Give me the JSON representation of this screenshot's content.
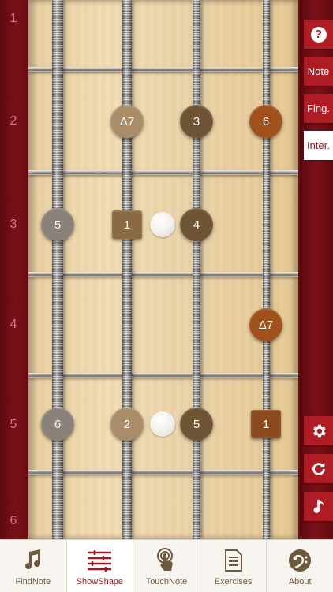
{
  "fret_numbers": [
    "1",
    "2",
    "3",
    "4",
    "5",
    "6"
  ],
  "side_buttons": {
    "help": "?",
    "note": "Note",
    "fingering": "Fing.",
    "interval": "Inter.",
    "settings_icon": "gear-icon",
    "refresh_icon": "refresh-icon",
    "sound_icon": "music-note-icon"
  },
  "notes": {
    "f2_s2": "Δ7",
    "f2_s3": "3",
    "f2_s4": "6",
    "f3_s1": "5",
    "f3_s2": "1",
    "f3_s3": "4",
    "f4_s4": "Δ7",
    "f5_s1": "6",
    "f5_s2": "2",
    "f5_s3": "5",
    "f5_s4": "1"
  },
  "tabs": [
    {
      "label": "FindNote",
      "icon": "music-note-icon",
      "active": false
    },
    {
      "label": "ShowShape",
      "icon": "sliders-icon",
      "active": true
    },
    {
      "label": "TouchNote",
      "icon": "touch-icon",
      "active": false
    },
    {
      "label": "Exercises",
      "icon": "document-icon",
      "active": false
    },
    {
      "label": "About",
      "icon": "bass-clef-icon",
      "active": false
    }
  ],
  "colors": {
    "accent": "#b01c24",
    "interval_root": "#8a5230",
    "interval_third": "#6e5435",
    "interval_fifth": "#8a8178",
    "interval_other": "#a88d68",
    "interval_sixth": "#a0501b"
  }
}
